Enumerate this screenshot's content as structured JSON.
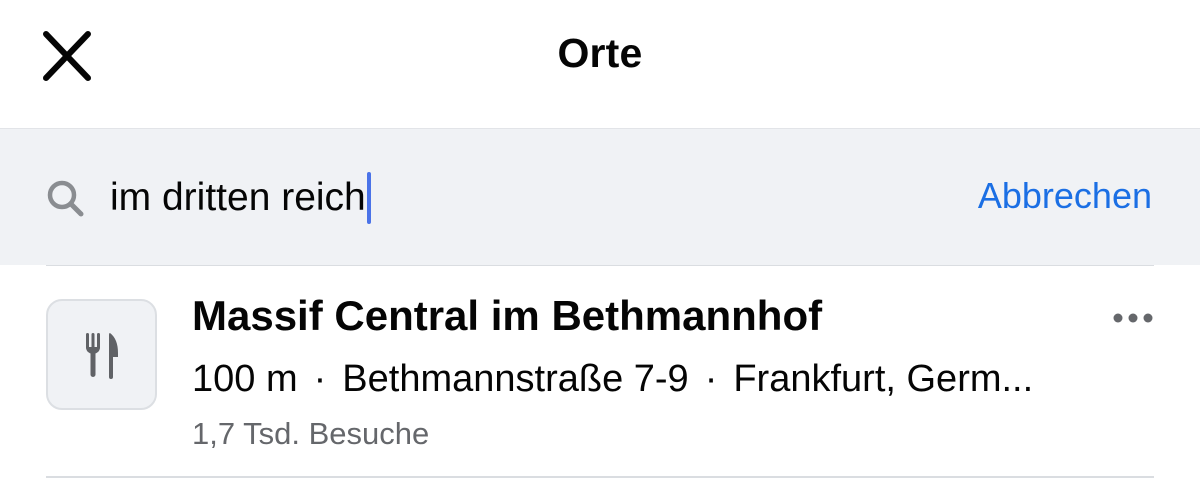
{
  "header": {
    "title": "Orte",
    "close_icon": "close-icon"
  },
  "search": {
    "icon": "search-icon",
    "query": "im dritten reich",
    "cancel_label": "Abbrechen"
  },
  "results": [
    {
      "icon": "restaurant-icon",
      "name": "Massif Central im Bethmannhof",
      "distance": "100 m",
      "separator": "·",
      "address": "Bethmannstraße 7-9",
      "city": "Frankfurt, Germ...",
      "visits": "1,7 Tsd. Besuche",
      "more_icon": "more-options-icon"
    }
  ],
  "colors": {
    "accent": "#1b6fe4",
    "search_bg": "#f0f2f5",
    "secondary_text": "#65676b",
    "caret": "#4a73e8"
  }
}
